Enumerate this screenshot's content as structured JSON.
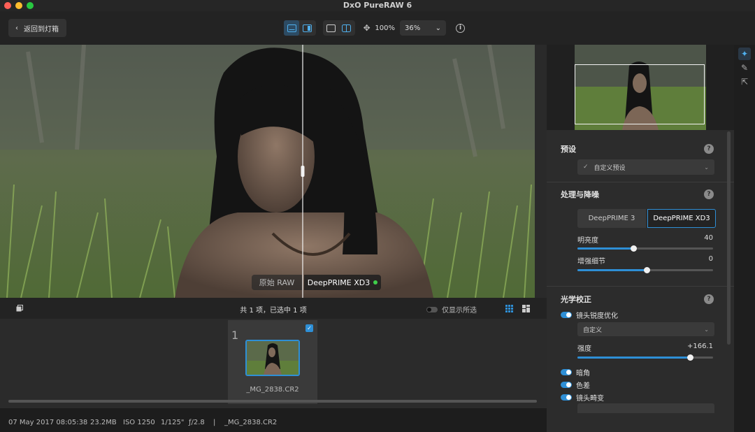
{
  "window": {
    "title": "DxO PureRAW 6"
  },
  "toolbar": {
    "back_label": "返回到灯箱",
    "zoom_fit": "100%",
    "zoom_level": "36%"
  },
  "viewer": {
    "left_label": "原始 RAW",
    "right_label": "DeepPRIME XD3"
  },
  "filmstrip": {
    "count_text": "共 1 项，已选中 1 项",
    "only_selected_label": "仅显示所选",
    "items": [
      {
        "index": "1",
        "filename": "_MG_2838.CR2",
        "selected": true
      }
    ]
  },
  "status": {
    "date": "07 May 2017 08:05:38",
    "size": "23.2MB",
    "iso": "ISO 1250",
    "shutter": "1/125\"",
    "aperture": "ƒ/2.8",
    "separator": "|",
    "filename": "_MG_2838.CR2"
  },
  "panel": {
    "preset": {
      "title": "预设",
      "value": "自定义预设"
    },
    "denoise": {
      "title": "处理与降噪",
      "modes": [
        "DeepPRIME 3",
        "DeepPRIME XD3"
      ],
      "selected_mode": "DeepPRIME XD3",
      "sliders": [
        {
          "label": "明亮度",
          "value": "40",
          "fraction": 0.41
        },
        {
          "label": "增强细节",
          "value": "0",
          "fraction": 0.51
        }
      ]
    },
    "optics": {
      "title": "光学校正",
      "sharpen_label": "镜头锐度优化",
      "sharpen_mode": "自定义",
      "strength_label": "强度",
      "strength_value": "+166.1",
      "strength_fraction": 0.83,
      "toggles": [
        "暗角",
        "色差",
        "镜头畸变"
      ]
    },
    "help_glyph": "?"
  },
  "colors": {
    "accent": "#2e8fd6",
    "background": "#1c1c1c",
    "panel": "#2c2c2c"
  }
}
